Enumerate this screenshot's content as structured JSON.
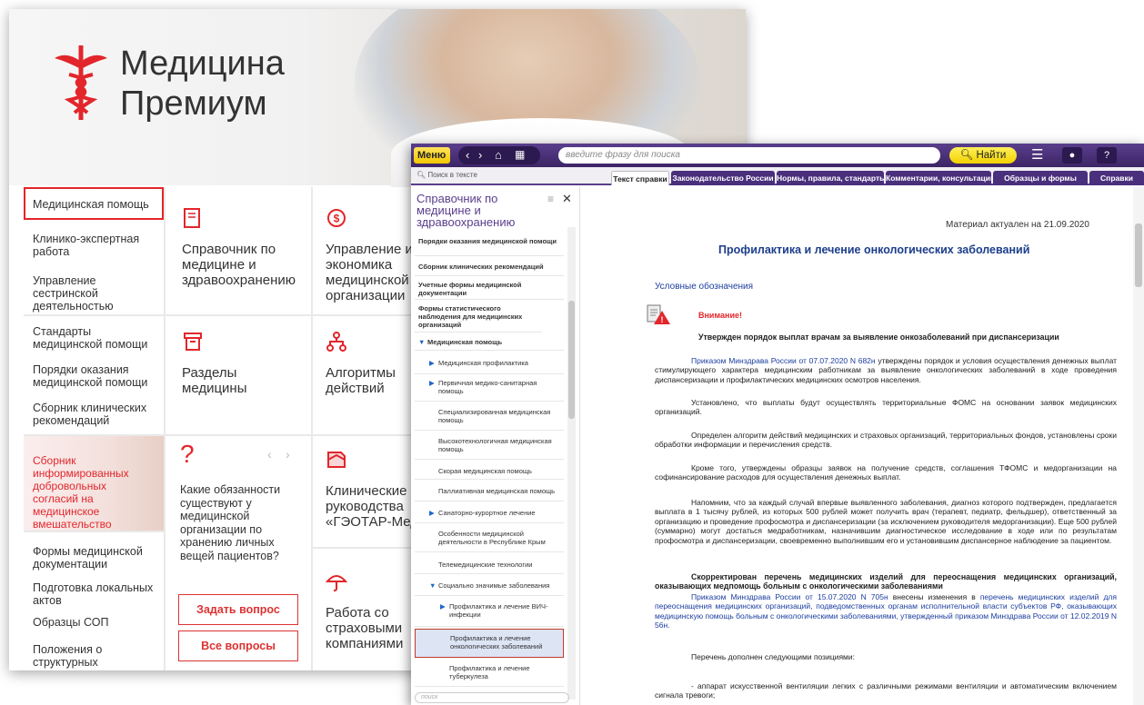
{
  "portal": {
    "brand": {
      "line1": "Медицина",
      "line2": "Премиум"
    },
    "col1": {
      "group1": [
        "Медицинская помощь",
        "Клинико-экспертная работа",
        "Управление сестринской деятельностью"
      ],
      "group2": [
        "Стандарты медицинской помощи",
        "Порядки оказания медицинской помощи",
        "Сборник клинических рекомендаций"
      ],
      "promo": "Сборник информированных добровольных согласий на медицинское вмешательство",
      "group3": [
        "Формы медицинской документации",
        "Подготовка локальных актов",
        "Образцы СОП",
        "Положения о структурных подразделениях"
      ]
    },
    "col2": {
      "handbook": "Справочник по медицине и здравоохранению",
      "sections": "Разделы медицины",
      "question": "Какие обязанности существуют у медицинской организации по хранению личных вещей пациентов?",
      "ask_btn": "Задать вопрос",
      "all_btn": "Все вопросы"
    },
    "col3": {
      "management": "Управление и экономика медицинской организации",
      "algorithms": "Алгоритмы действий",
      "guides": "Клинические руководства «ГЭОТАР-Медиа»",
      "insurance": "Работа со страховыми компаниями"
    }
  },
  "app": {
    "menu_label": "Меню",
    "search_placeholder": "введите фразу для поиска",
    "find_label": "Найти",
    "search_in_text": "Поиск в тексте",
    "tabs": [
      "Текст справки",
      "Законодательство России",
      "Нормы, правила, стандарты",
      "Комментарии, консультации",
      "Образцы и формы",
      "Справки"
    ],
    "sidebar": {
      "title": "Справочник по медицине и здравоохранению",
      "items": [
        "Порядки оказания медицинской помощи",
        "Сборник клинических рекомендаций",
        "Учетные формы медицинской документации",
        "Формы статистического наблюдения для медицинских организаций",
        "Медицинская помощь",
        "Медицинская профилактика",
        "Первичная медико-санитарная помощь",
        "Специализированная медицинская помощь",
        "Высокотехнологичная медицинская помощь",
        "Скорая медицинская помощь",
        "Паллиативная медицинская помощь",
        "Санаторно-курортное лечение",
        "Особенности медицинской деятельности в Республике Крым",
        "Телемедицинские технологии",
        "Социально значимые заболевания",
        "Профилактика и лечение ВИЧ-инфекции",
        "Профилактика и лечение онкологических заболеваний",
        "Профилактика и лечение туберкулеза"
      ],
      "search_placeholder": "поиск"
    },
    "doc": {
      "actual": "Материал актуален на 21.09.2020",
      "title": "Профилактика и лечение онкологических заболеваний",
      "legend": "Условные обозначения",
      "attention": "Внимание!",
      "headline1": "Утвержден порядок выплат врачам за выявление онкозаболеваний при диспансеризации",
      "p1_link": "Приказом Минздрава России от 07.07.2020 N 682н",
      "p1_rest": " утверждены порядок и условия осуществления денежных выплат стимулирующего характера медицинским работникам за выявление онкологических заболеваний в ходе проведения диспансеризации и профилактических медицинских осмотров населения.",
      "p2": "Установлено, что выплаты будут осуществлять территориальные ФОМС на основании заявок медицинских организаций.",
      "p3": "Определен алгоритм действий медицинских и страховых организаций, территориальных фондов, установлены сроки обработки информации и перечисления средств.",
      "p4": "Кроме того, утверждены образцы заявок на получение средств, соглашения ТФОМС и медорганизации на софинансирование расходов для осуществления денежных выплат.",
      "p5": "Напомним, что за каждый случай впервые выявленного заболевания, диагноз которого подтвержден, предлагается выплата в 1 тысячу рублей, из которых 500 рублей может получить врач (терапевт, педиатр, фельдшер), ответственный за организацию и проведение профосмотра и диспансеризации (за исключением руководителя медорганизации). Еще 500 рублей (суммарно) могут достаться медработникам, назначившим диагностическое исследование в ходе или по результатам профосмотра и диспансеризации, своевременно выполнившим его и установившим диспансерное наблюдение за пациентом.",
      "headline2": "Скорректирован перечень медицинских изделий для переоснащения медицинских организаций, оказывающих медпомощь больным с онкологическими заболеваниями",
      "p6_link": "Приказом Минздрава России от 15.07.2020 N 705н",
      "p6_mid": " внесены изменения в ",
      "p6_link2": "перечень медицинских изделий для переоснащения медицинских организаций, подведомственных органам исполнительной власти субъектов РФ, оказывающих медицинскую помощь больным с онкологическими заболеваниями, утвержденный приказом Минздрава России от 12.02.2019 N 56н.",
      "p7": "Перечень дополнен следующими позициями:",
      "p8": "- аппарат искусственной вентиляции легких с различными режимами вентиляции и автоматическим включением сигнала тревоги;"
    }
  },
  "colors": {
    "brand_red": "#e2262b",
    "app_purple": "#4a2f7c",
    "accent_yellow": "#f3d100"
  }
}
